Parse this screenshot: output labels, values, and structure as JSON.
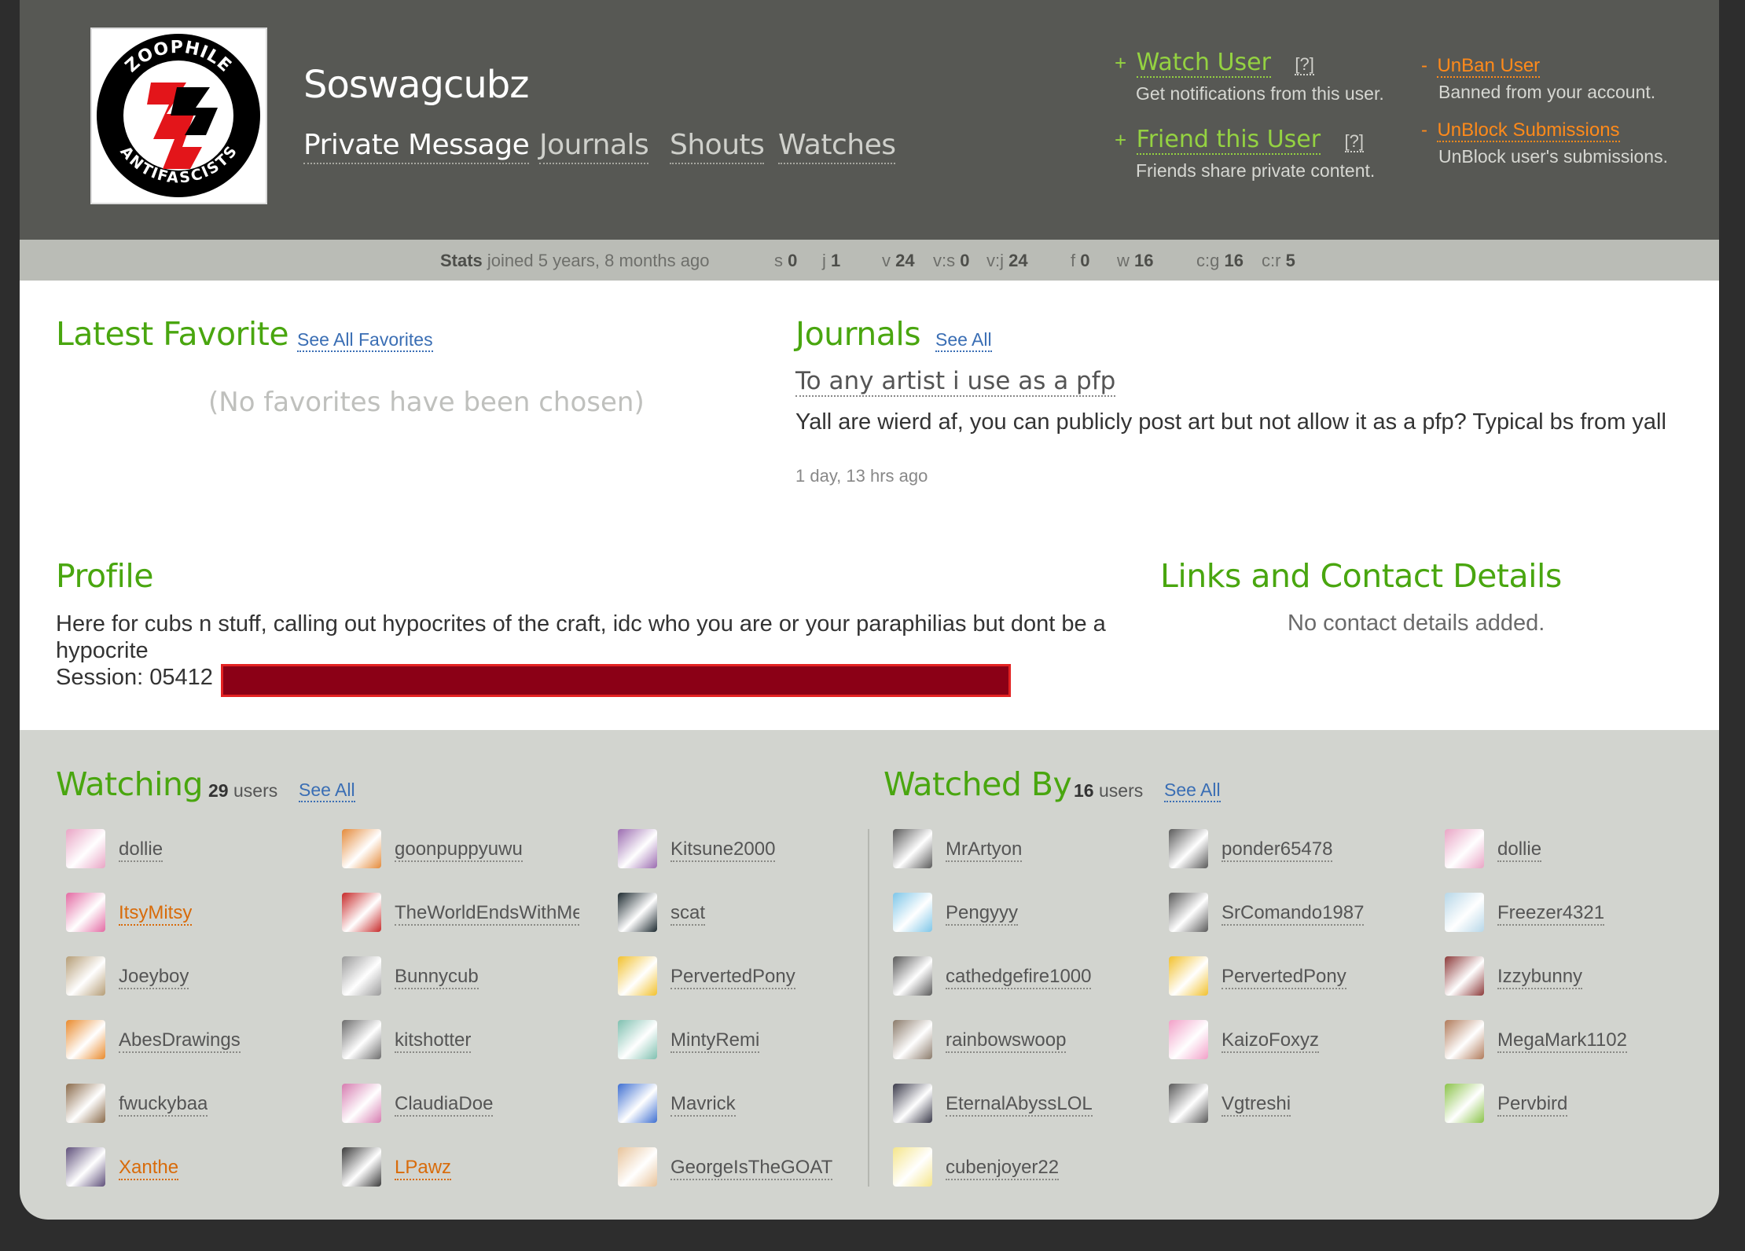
{
  "profile": {
    "username": "Soswagcubz",
    "avatar_icon": "zoophile-antifascists-logo",
    "avatar_text_top": "ZOOPHILE",
    "avatar_text_bottom": "ANTIFASCISTS",
    "nav": {
      "pm": "Private Message",
      "journals": "Journals",
      "shouts": "Shouts",
      "watches": "Watches"
    }
  },
  "actions": {
    "watch": {
      "plus": "+",
      "label": "Watch User",
      "help": "[?]",
      "desc": "Get notifications from this user."
    },
    "friend": {
      "plus": "+",
      "label": "Friend this User",
      "help": "[?]",
      "desc": "Friends share private content."
    },
    "unban": {
      "minus": "-",
      "label": "UnBan User",
      "desc": "Banned from your account."
    },
    "unblock": {
      "minus": "-",
      "label": "UnBlock Submissions",
      "desc": "UnBlock user's submissions."
    }
  },
  "stats": {
    "label": "Stats",
    "joined": "joined 5 years, 8 months ago",
    "s": {
      "k": "s",
      "v": "0"
    },
    "j": {
      "k": "j",
      "v": "1"
    },
    "v": {
      "k": "v",
      "v": "24"
    },
    "vs": {
      "k": "v:s",
      "v": "0"
    },
    "vj": {
      "k": "v:j",
      "v": "24"
    },
    "f": {
      "k": "f",
      "v": "0"
    },
    "w": {
      "k": "w",
      "v": "16"
    },
    "cg": {
      "k": "c:g",
      "v": "16"
    },
    "cr": {
      "k": "c:r",
      "v": "5"
    }
  },
  "favorites": {
    "title": "Latest Favorite",
    "see_all": "See All Favorites",
    "empty": "(No favorites have been chosen)"
  },
  "journals": {
    "title": "Journals",
    "see_all": "See All",
    "latest_title": "To any artist i use as a pfp",
    "latest_body": "Yall are wierd af, you can publicly post art but not allow it as a pfp? Typical bs from yall",
    "latest_date": "1 day, 13 hrs ago"
  },
  "profile_section": {
    "title": "Profile",
    "text_line1": "Here for cubs n stuff, calling out hypocrites of the craft, idc who you are or your paraphilias but dont be a hypocrite",
    "text_line2": "Session: 05412"
  },
  "contact": {
    "title": "Links and Contact Details",
    "empty": "No contact details added."
  },
  "watching": {
    "title": "Watching",
    "count": "29",
    "count_suffix": "users",
    "see_all": "See All",
    "users": [
      {
        "name": "dollie",
        "color": "#e9a5c5"
      },
      {
        "name": "goonpuppyuwu",
        "color": "#e48a3a"
      },
      {
        "name": "Kitsune2000",
        "color": "#9b6bb0"
      },
      {
        "name": "ItsyMitsy",
        "color": "#e36aa3"
      },
      {
        "name": "TheWorldEndsWithMe",
        "color": "#c72a2a"
      },
      {
        "name": "scat",
        "color": "#1d2a30"
      },
      {
        "name": "Joeyboy",
        "color": "#b59d76"
      },
      {
        "name": "Bunnycub",
        "color": "#9a9a9a"
      },
      {
        "name": "PervertedPony",
        "color": "#f2c12e"
      },
      {
        "name": "AbesDrawings",
        "color": "#e98a2c"
      },
      {
        "name": "kitshotter",
        "color": "#6c6c6c"
      },
      {
        "name": "MintyRemi",
        "color": "#7fc0b0"
      },
      {
        "name": "fwuckybaa",
        "color": "#8a6a4a"
      },
      {
        "name": "ClaudiaDoe",
        "color": "#d67cb0"
      },
      {
        "name": "Mavrick",
        "color": "#3f6fd1"
      },
      {
        "name": "Xanthe",
        "color": "#5e4f7a"
      },
      {
        "name": "LPawz",
        "color": "#3b3b3b"
      },
      {
        "name": "GeorgeIsTheGOAT",
        "color": "#e8c39a"
      }
    ]
  },
  "watched_by": {
    "title": "Watched By",
    "count": "16",
    "count_suffix": "users",
    "see_all": "See All",
    "users": [
      {
        "name": "MrArtyon",
        "color": "#5a5a5a"
      },
      {
        "name": "ponder65478",
        "color": "#5a5a5a"
      },
      {
        "name": "dollie",
        "color": "#e9a5c5"
      },
      {
        "name": "Pengyyy",
        "color": "#7ec6e8"
      },
      {
        "name": "SrComando1987",
        "color": "#5a5a5a"
      },
      {
        "name": "Freezer4321",
        "color": "#b7d7e8"
      },
      {
        "name": "cathedgefire1000",
        "color": "#5a5a5a"
      },
      {
        "name": "PervertedPony",
        "color": "#f2c12e"
      },
      {
        "name": "Izzybunny",
        "color": "#8c3a3a"
      },
      {
        "name": "rainbowswoop",
        "color": "#8a7a6a"
      },
      {
        "name": "KaizoFoxyz",
        "color": "#f2a0c8"
      },
      {
        "name": "MegaMark1102",
        "color": "#b07a5a"
      },
      {
        "name": "EternalAbyssLOL",
        "color": "#3a3a4a"
      },
      {
        "name": "Vgtreshi",
        "color": "#5a5a5a"
      },
      {
        "name": "Pervbird",
        "color": "#8bc34a"
      },
      {
        "name": "cubenjoyer22",
        "color": "#f5e58a"
      }
    ]
  },
  "colors": {
    "accent_green": "#49a60f",
    "link_blue": "#3a6eb4",
    "orange": "#ff8a1a",
    "header_bg": "#575854"
  }
}
